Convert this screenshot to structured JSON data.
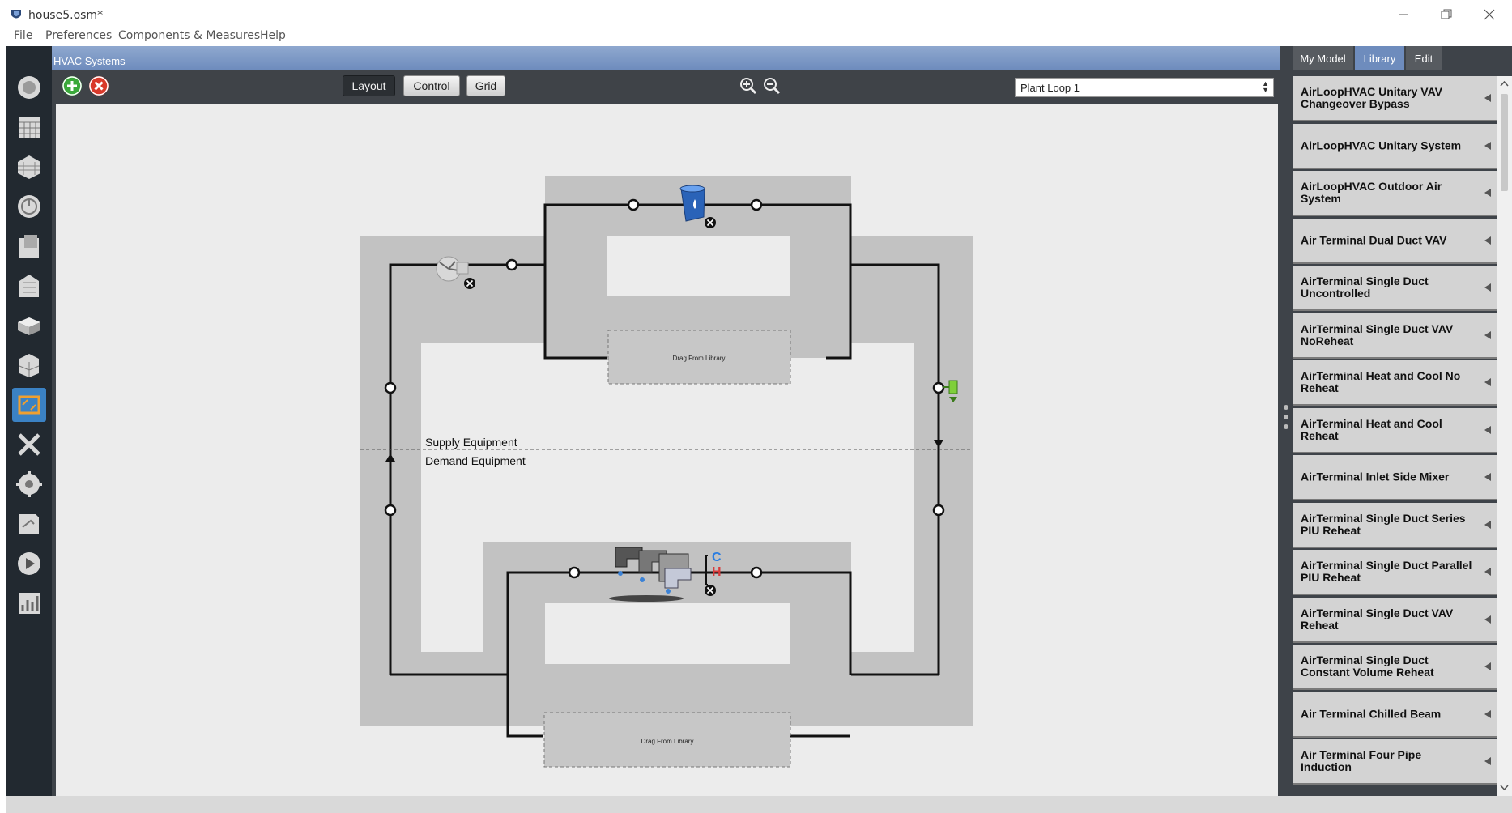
{
  "window": {
    "title": "house5.osm*"
  },
  "menu": [
    "File",
    "Preferences",
    "Components & Measures",
    "Help"
  ],
  "left_toolbar": [
    {
      "icon": "site-icon"
    },
    {
      "icon": "schedules-icon"
    },
    {
      "icon": "constructions-icon"
    },
    {
      "icon": "loads-icon"
    },
    {
      "icon": "space-types-icon"
    },
    {
      "icon": "geometry-icon"
    },
    {
      "icon": "facility-icon"
    },
    {
      "icon": "spaces-icon"
    },
    {
      "icon": "hvac-systems-icon",
      "active": true
    },
    {
      "icon": "building-summary-icon"
    },
    {
      "icon": "measures-icon"
    },
    {
      "icon": "simulation-settings-icon"
    },
    {
      "icon": "run-simulation-icon"
    },
    {
      "icon": "results-summary-icon"
    }
  ],
  "panel": {
    "title": "HVAC Systems",
    "view_buttons": [
      "Layout",
      "Control",
      "Grid"
    ],
    "active_view": "Layout",
    "loop_select": "Plant Loop 1"
  },
  "diagram": {
    "supply_label": "Supply Equipment",
    "demand_label": "Demand Equipment",
    "supply_drop_zone": "Drag From Library",
    "demand_drop_zone": "Drag From Library"
  },
  "right_panel": {
    "tabs": [
      "My Model",
      "Library",
      "Edit"
    ],
    "active_tab": "Library",
    "library_items": [
      "AirLoopHVAC Unitary VAV Changeover Bypass",
      "AirLoopHVAC Unitary System",
      "AirLoopHVAC Outdoor Air System",
      "Air Terminal Dual Duct VAV",
      "AirTerminal Single Duct Uncontrolled",
      "AirTerminal Single Duct VAV NoReheat",
      "AirTerminal Heat and Cool No Reheat",
      "AirTerminal Heat and Cool Reheat",
      "AirTerminal Inlet Side Mixer",
      "AirTerminal Single Duct Series PIU Reheat",
      "AirTerminal Single Duct Parallel PIU Reheat",
      "AirTerminal Single Duct VAV Reheat",
      "AirTerminal Single Duct Constant Volume Reheat",
      "Air Terminal Chilled Beam",
      "Air Terminal Four Pipe Induction"
    ]
  },
  "colors": {
    "accent": "#6e8cbd",
    "panel_dark": "#3e4349",
    "zone_gray": "#c2c2c2",
    "add_green": "#3aa83a",
    "remove_red": "#d93a2b"
  }
}
